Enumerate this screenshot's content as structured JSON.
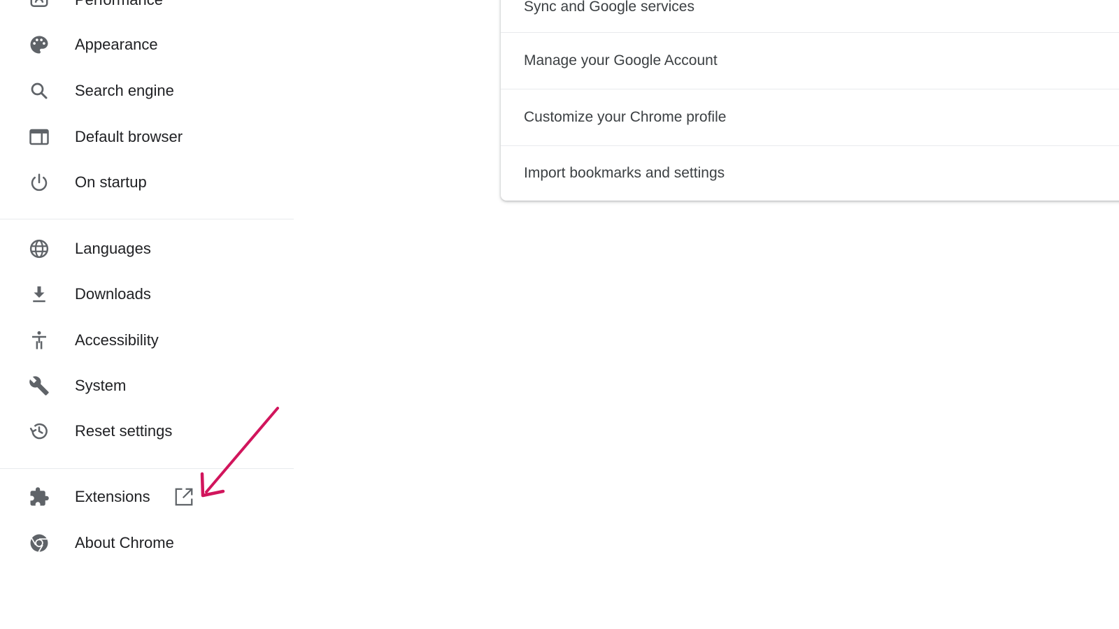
{
  "sidebar": {
    "items": [
      {
        "label": "Performance",
        "icon": "speedometer-icon"
      },
      {
        "label": "Appearance",
        "icon": "palette-icon"
      },
      {
        "label": "Search engine",
        "icon": "search-icon"
      },
      {
        "label": "Default browser",
        "icon": "browser-window-icon"
      },
      {
        "label": "On startup",
        "icon": "power-icon"
      },
      {
        "label": "Languages",
        "icon": "globe-icon"
      },
      {
        "label": "Downloads",
        "icon": "download-icon"
      },
      {
        "label": "Accessibility",
        "icon": "accessibility-icon"
      },
      {
        "label": "System",
        "icon": "wrench-icon"
      },
      {
        "label": "Reset settings",
        "icon": "history-icon"
      },
      {
        "label": "Extensions",
        "icon": "puzzle-icon",
        "external_icon": "open-in-new-icon"
      },
      {
        "label": "About Chrome",
        "icon": "chrome-icon"
      }
    ]
  },
  "card": {
    "rows": [
      {
        "label": "Sync and Google services"
      },
      {
        "label": "Manage your Google Account"
      },
      {
        "label": "Customize your Chrome profile"
      },
      {
        "label": "Import bookmarks and settings"
      }
    ]
  },
  "annotation": {
    "arrow_color": "#d1155c"
  },
  "colors": {
    "icon": "#5f6368",
    "text": "#202124",
    "divider": "#e8eaed"
  }
}
